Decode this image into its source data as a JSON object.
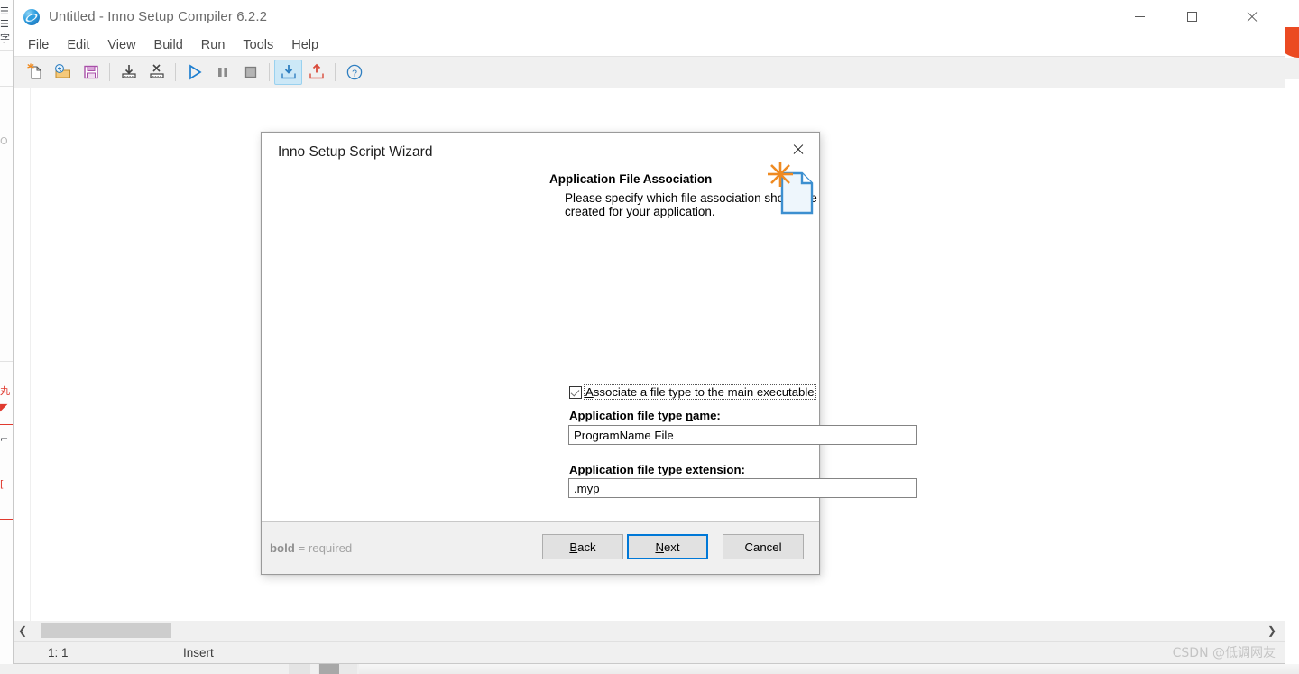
{
  "window": {
    "title": "Untitled - Inno Setup Compiler 6.2.2",
    "app_icon": "inno-setup-globe-icon",
    "controls": {
      "minimize": "minimize-icon",
      "maximize": "maximize-icon",
      "close": "close-icon"
    }
  },
  "menu": {
    "items": [
      {
        "label": "File"
      },
      {
        "label": "Edit"
      },
      {
        "label": "View"
      },
      {
        "label": "Build"
      },
      {
        "label": "Run"
      },
      {
        "label": "Tools"
      },
      {
        "label": "Help"
      }
    ]
  },
  "toolbar": {
    "buttons": [
      {
        "name": "new-file-icon",
        "active": false
      },
      {
        "name": "open-file-icon",
        "active": false
      },
      {
        "name": "save-file-icon",
        "active": false
      },
      {
        "name": "separator-1",
        "active": false
      },
      {
        "name": "compile-icon",
        "active": false
      },
      {
        "name": "stop-compile-icon",
        "active": false
      },
      {
        "name": "separator-2",
        "active": false
      },
      {
        "name": "run-icon",
        "active": false
      },
      {
        "name": "pause-icon",
        "active": false
      },
      {
        "name": "stop-icon",
        "active": false
      },
      {
        "name": "separator-3",
        "active": false
      },
      {
        "name": "import-icon",
        "active": true
      },
      {
        "name": "export-icon",
        "active": false
      },
      {
        "name": "separator-4",
        "active": false
      },
      {
        "name": "help-icon",
        "active": false
      }
    ]
  },
  "status_bar": {
    "position": "1:  1",
    "mode": "Insert",
    "watermark": "CSDN @低调网友"
  },
  "dialog": {
    "title": "Inno Setup Script Wizard",
    "close_icon": "close-icon",
    "heading": "Application File Association",
    "subheading": "Please specify which file association should be created for your application.",
    "graphic": "document-with-starburst-icon",
    "checkbox": {
      "checked": true,
      "label_prefix": "",
      "label_accel": "A",
      "label_rest": "ssociate a file type to the main executable"
    },
    "fields": [
      {
        "label_prefix": "Application file type ",
        "label_accel": "n",
        "label_rest": "ame:",
        "value": "ProgramName File",
        "name": "application-file-type-name"
      },
      {
        "label_prefix": "Application file type ",
        "label_accel": "e",
        "label_rest": "xtension:",
        "value": ".myp",
        "name": "application-file-type-extension"
      }
    ],
    "footer": {
      "required_bold": "bold",
      "required_rest": " = required",
      "buttons": [
        {
          "accel": "B",
          "rest": "ack",
          "name": "back-button",
          "default": false
        },
        {
          "accel": "N",
          "rest": "ext",
          "name": "next-button",
          "default": true
        },
        {
          "accel": "",
          "rest": "Cancel",
          "name": "cancel-button",
          "default": false
        }
      ]
    }
  },
  "colors": {
    "accent": "#0078d7",
    "toolbar_active": "#cce8f7",
    "dialog_footer": "#f0f0f0"
  }
}
